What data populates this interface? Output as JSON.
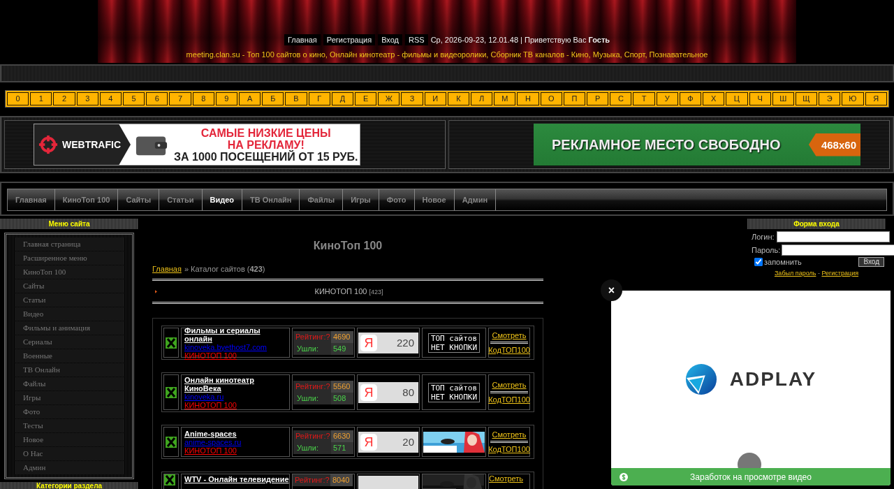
{
  "header": {
    "links": [
      "Главная",
      "Регистрация",
      "Вход",
      "RSS"
    ],
    "greeting": "Ср, 2026-09-23, 12.01.48 | Приветствую Вас **Гость**",
    "tagline": "meeting.clan.su - Топ 100 сайтов о кино, Онлайн кинотеатр - фильмы и видеоролики, Сборник ТВ каналов - Кино, Музыка, Спорт, Познавательное"
  },
  "alphabet": [
    "0",
    "1",
    "2",
    "3",
    "4",
    "5",
    "6",
    "7",
    "8",
    "9",
    "А",
    "Б",
    "В",
    "Г",
    "Д",
    "Е",
    "Ж",
    "З",
    "И",
    "К",
    "Л",
    "М",
    "Н",
    "О",
    "П",
    "Р",
    "С",
    "Т",
    "У",
    "Ф",
    "Х",
    "Ц",
    "Ч",
    "Ш",
    "Щ",
    "Э",
    "Ю",
    "Я"
  ],
  "banners": {
    "left": {
      "brand": "WEBTRAFIC",
      "headline": [
        "САМЫЕ НИЗКИЕ ЦЕНЫ",
        "НА РЕКЛАМУ!"
      ],
      "offer": "ЗА 1000 ПОСЕЩЕНИЙ ОТ 15 РУБ."
    },
    "right": {
      "text": "РЕКЛАМНОЕ МЕСТО СВОБОДНО",
      "size": "468x60"
    }
  },
  "nav": [
    {
      "label": "Главная",
      "selected": false
    },
    {
      "label": "КиноТоп 100",
      "selected": false
    },
    {
      "label": "Сайты",
      "selected": false
    },
    {
      "label": "Статьи",
      "selected": false
    },
    {
      "label": "Видео",
      "selected": true
    },
    {
      "label": "ТВ Онлайн",
      "selected": false
    },
    {
      "label": "Файлы",
      "selected": false
    },
    {
      "label": "Игры",
      "selected": false
    },
    {
      "label": "Фото",
      "selected": false
    },
    {
      "label": "Новое",
      "selected": false
    },
    {
      "label": "Админ",
      "selected": false
    }
  ],
  "site_menu": {
    "title": "Меню сайта",
    "items": [
      "Главная страница",
      "Расширенное меню",
      "КиноТоп 100",
      "Сайты",
      "Статьи",
      "Видео",
      "Фильмы и анимация",
      "Сериалы",
      "Военные",
      "ТВ Онлайн",
      "Файлы",
      "Игры",
      "Фото",
      "Тесты",
      "Новое",
      "О Нас",
      "Админ"
    ],
    "next_title": "Категории раздела"
  },
  "main": {
    "title": "КиноТоп 100",
    "breadcrumb": {
      "home": "Главная",
      "current": "» Каталог сайтов (**423**)"
    },
    "category": {
      "name": "КИНОТОП 100",
      "count": "[423]"
    },
    "sites": [
      {
        "name": "Фильмы и сериалы онлайн",
        "url": "kinoveka.byethost7.com",
        "category": "КИНОТОП 100",
        "rating_label": "Рейтинг:?",
        "rating": "4690",
        "out_label": "Ушли:",
        "out": "549",
        "counter_logo": "Я",
        "counter": "220",
        "button": {
          "kind": "text",
          "lines": [
            "ТОП сайтов",
            "НЕТ КНОПКИ"
          ]
        },
        "view": "Смотреть",
        "code": "КодТОП100"
      },
      {
        "name": "Онлайн кинотеатр КиноВека",
        "url": "kinoveka.ru",
        "category": "КИНОТОП 100",
        "rating_label": "Рейтинг:?",
        "rating": "5560",
        "out_label": "Ушли:",
        "out": "508",
        "counter_logo": "Я",
        "counter": "80",
        "button": {
          "kind": "text",
          "lines": [
            "ТОП сайтов",
            "НЕТ КНОПКИ"
          ]
        },
        "view": "Смотреть",
        "code": "КодТОП100"
      },
      {
        "name": "Anime-spaces",
        "url": "anime-spaces.ru",
        "category": "КИНОТОП 100",
        "rating_label": "Рейтинг:?",
        "rating": "6630",
        "out_label": "Ушли:",
        "out": "571",
        "counter_logo": "Я",
        "counter": "20",
        "view": "Смотреть",
        "code": "КодТОП100"
      },
      {
        "name": "WTV - Онлайн телевидение",
        "rating_label": "Рейтинг:?",
        "rating": "8040",
        "view": "Смотреть"
      }
    ]
  },
  "login": {
    "title": "Форма входа",
    "login_label": "Логин:",
    "password_label": "Пароль:",
    "remember": {
      "label": "запомнить",
      "checked": true
    },
    "submit": "Вход",
    "forgot": "Забыл пароль",
    "separator": "-",
    "register": "Регистрация"
  },
  "ad": {
    "close": "×",
    "brand": "ADPLAY",
    "caption": "Заработок на просмотре видео"
  }
}
